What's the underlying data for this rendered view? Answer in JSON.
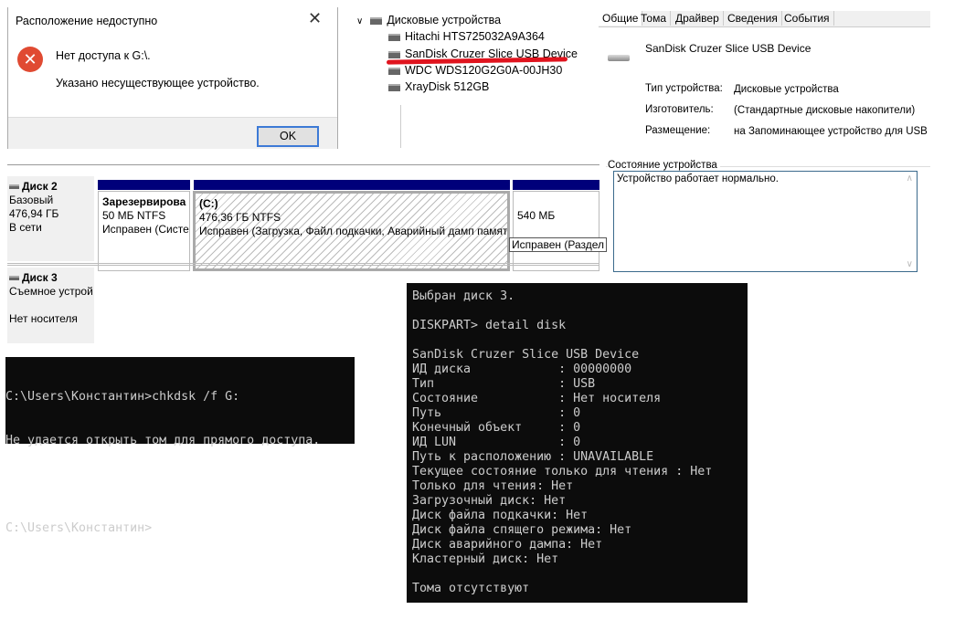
{
  "error_dialog": {
    "title": "Расположение недоступно",
    "message": "Нет доступа к G:\\.",
    "detail": "Указано несуществующее устройство.",
    "ok_label": "OK"
  },
  "device_tree": {
    "category": "Дисковые устройства",
    "items": [
      "Hitachi HTS725032A9A364",
      "SanDisk Cruzer Slice USB Device",
      "WDC WDS120G2G0A-00JH30",
      "XrayDisk 512GB"
    ]
  },
  "properties": {
    "tabs": [
      "Общие",
      "Тома",
      "Драйвер",
      "Сведения",
      "События"
    ],
    "device_name": "SanDisk Cruzer Slice USB Device",
    "rows": [
      {
        "label": "Тип устройства:",
        "value": "Дисковые устройства"
      },
      {
        "label": "Изготовитель:",
        "value": "(Стандартные дисковые накопители)"
      },
      {
        "label": "Размещение:",
        "value": "на Запоминающее устройство для USB"
      }
    ],
    "status_group": "Состояние устройства",
    "status_text": "Устройство работает нормально."
  },
  "disk_management": {
    "disk2": {
      "name": "Диск 2",
      "type": "Базовый",
      "size": "476,94 ГБ",
      "state": "В сети",
      "partitions": [
        {
          "name": "Зарезервирова",
          "size": "50 МБ NTFS",
          "status": "Исправен (Систе"
        },
        {
          "name": "(C:)",
          "size": "476,36 ГБ NTFS",
          "status": "Исправен (Загрузка, Файл подкачки, Аварийный дамп памяти"
        },
        {
          "name": "",
          "size": "540 МБ",
          "status": "Исправен (Раздел"
        }
      ]
    },
    "disk3": {
      "name": "Диск 3",
      "type": "Съемное устрой",
      "state": "Нет носителя"
    }
  },
  "chkdsk_console": {
    "lines": [
      "C:\\Users\\Константин>chkdsk /f G:",
      "Не удается открыть том для прямого доступа.",
      "",
      "C:\\Users\\Константин>"
    ]
  },
  "diskpart_console": {
    "lines": [
      "Выбран диск 3.",
      "",
      "DISKPART> detail disk",
      "",
      "SanDisk Cruzer Slice USB Device",
      "ИД диска            : 00000000",
      "Тип                 : USB",
      "Состояние           : Нет носителя",
      "Путь                : 0",
      "Конечный объект     : 0",
      "ИД LUN              : 0",
      "Путь к расположению : UNAVAILABLE",
      "Текущее состояние только для чтения : Нет",
      "Только для чтения: Нет",
      "Загрузочный диск: Нет",
      "Диск файла подкачки: Нет",
      "Диск файла спящего режима: Нет",
      "Диск аварийного дампа: Нет",
      "Кластерный диск: Нет",
      "",
      "Тома отсутствуют"
    ]
  }
}
